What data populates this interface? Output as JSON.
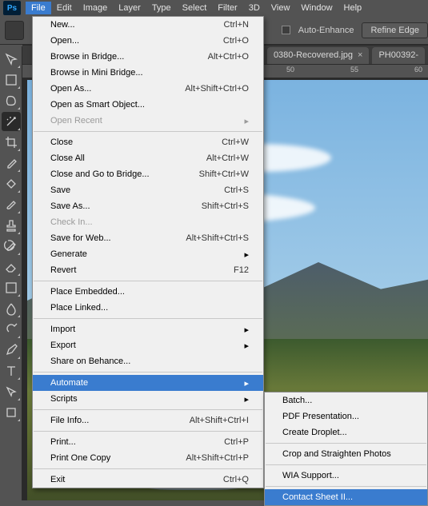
{
  "menubar": {
    "items": [
      "File",
      "Edit",
      "Image",
      "Layer",
      "Type",
      "Select",
      "Filter",
      "3D",
      "View",
      "Window",
      "Help"
    ],
    "active_index": 0,
    "logo_text": "Ps"
  },
  "optionsbar": {
    "auto_enhance_label": "Auto-Enhance",
    "refine_edge_label": "Refine Edge"
  },
  "tabs": [
    {
      "label": "0380-Recovered.jpg"
    },
    {
      "label": "PH00392-"
    }
  ],
  "ruler": {
    "marks": [
      "50",
      "55",
      "60"
    ]
  },
  "tool_icons": [
    "move",
    "marquee",
    "lasso",
    "magic-wand",
    "crop",
    "eyedropper",
    "healing",
    "brush",
    "stamp",
    "history-brush",
    "eraser",
    "gradient",
    "blur",
    "dodge",
    "pen",
    "type",
    "path-select",
    "rectangle"
  ],
  "selected_tool_index": 3,
  "file_menu": {
    "groups": [
      [
        {
          "label": "New...",
          "shortcut": "Ctrl+N"
        },
        {
          "label": "Open...",
          "shortcut": "Ctrl+O"
        },
        {
          "label": "Browse in Bridge...",
          "shortcut": "Alt+Ctrl+O"
        },
        {
          "label": "Browse in Mini Bridge...",
          "shortcut": ""
        },
        {
          "label": "Open As...",
          "shortcut": "Alt+Shift+Ctrl+O"
        },
        {
          "label": "Open as Smart Object...",
          "shortcut": ""
        },
        {
          "label": "Open Recent",
          "shortcut": "",
          "submenu": true,
          "disabled": true
        }
      ],
      [
        {
          "label": "Close",
          "shortcut": "Ctrl+W"
        },
        {
          "label": "Close All",
          "shortcut": "Alt+Ctrl+W"
        },
        {
          "label": "Close and Go to Bridge...",
          "shortcut": "Shift+Ctrl+W"
        },
        {
          "label": "Save",
          "shortcut": "Ctrl+S"
        },
        {
          "label": "Save As...",
          "shortcut": "Shift+Ctrl+S"
        },
        {
          "label": "Check In...",
          "shortcut": "",
          "disabled": true
        },
        {
          "label": "Save for Web...",
          "shortcut": "Alt+Shift+Ctrl+S"
        },
        {
          "label": "Generate",
          "shortcut": "",
          "submenu": true
        },
        {
          "label": "Revert",
          "shortcut": "F12"
        }
      ],
      [
        {
          "label": "Place Embedded...",
          "shortcut": ""
        },
        {
          "label": "Place Linked...",
          "shortcut": ""
        }
      ],
      [
        {
          "label": "Import",
          "shortcut": "",
          "submenu": true
        },
        {
          "label": "Export",
          "shortcut": "",
          "submenu": true
        },
        {
          "label": "Share on Behance...",
          "shortcut": ""
        }
      ],
      [
        {
          "label": "Automate",
          "shortcut": "",
          "submenu": true,
          "hover": true
        },
        {
          "label": "Scripts",
          "shortcut": "",
          "submenu": true
        }
      ],
      [
        {
          "label": "File Info...",
          "shortcut": "Alt+Shift+Ctrl+I"
        }
      ],
      [
        {
          "label": "Print...",
          "shortcut": "Ctrl+P"
        },
        {
          "label": "Print One Copy",
          "shortcut": "Alt+Shift+Ctrl+P"
        }
      ],
      [
        {
          "label": "Exit",
          "shortcut": "Ctrl+Q"
        }
      ]
    ]
  },
  "automate_menu": {
    "groups": [
      [
        {
          "label": "Batch..."
        },
        {
          "label": "PDF Presentation..."
        },
        {
          "label": "Create Droplet..."
        }
      ],
      [
        {
          "label": "Crop and Straighten Photos"
        }
      ],
      [
        {
          "label": "WIA Support..."
        }
      ],
      [
        {
          "label": "Contact Sheet II...",
          "hover": true
        }
      ]
    ]
  }
}
